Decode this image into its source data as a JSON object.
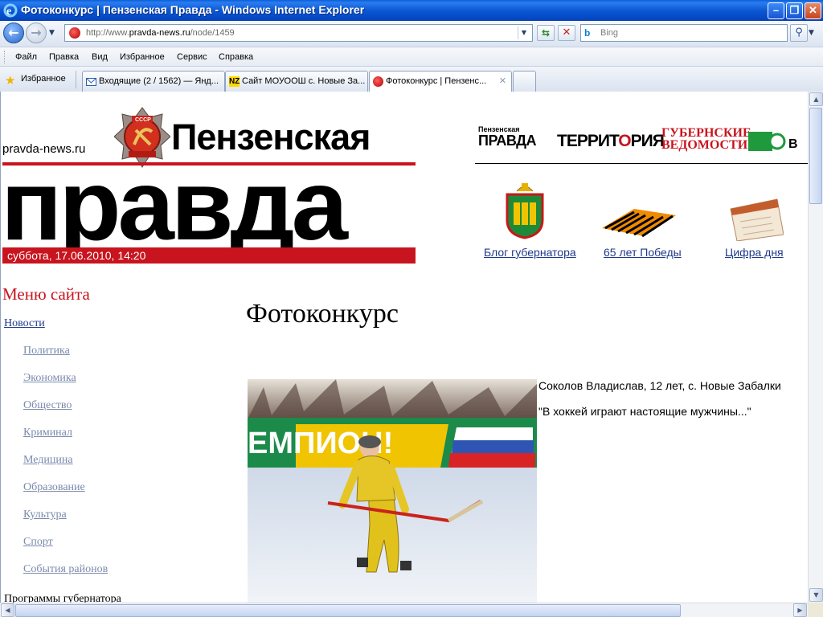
{
  "window": {
    "title": "Фотоконкурс | Пензенская Правда - Windows Internet Explorer",
    "minimize": "–",
    "restore": "❐",
    "close": "✕"
  },
  "address": {
    "url_prefix": "http://www.",
    "url_domain": "pravda-news.ru",
    "url_path": "/node/1459",
    "search_placeholder": "Bing",
    "search_engine": "b"
  },
  "menu": [
    "Файл",
    "Правка",
    "Вид",
    "Избранное",
    "Сервис",
    "Справка"
  ],
  "favorites_label": "Избранное",
  "tabs": [
    {
      "label": "Входящие (2 / 1562) — Янд...",
      "icon": "mail-icon"
    },
    {
      "label": "Сайт МОУООШ с. Новые За...",
      "icon": "nz-icon",
      "icon_text": "NZ"
    },
    {
      "label": "Фотоконкурс | Пензенс...",
      "icon": "site-icon",
      "active": true
    }
  ],
  "header": {
    "site_name": "pravda-news.ru",
    "logo_line1": "Пензенская",
    "logo_line2": "правда",
    "date": "суббота, 17.06.2010, 14:20"
  },
  "partners": {
    "pp_small": "Пензенская",
    "pp_big": "ПРАВДА",
    "territory_a": "ТЕРРИТ",
    "territory_b": "О",
    "territory_c": "РИЯ",
    "gv_line1": "ГУБЕРНСКИЕ",
    "gv_line2": "ВЕДОМОСТИ"
  },
  "quick_links": [
    {
      "label": "Блог губернатора",
      "icon": "coat-of-arms-icon"
    },
    {
      "label": "65 лет Победы",
      "icon": "st-george-ribbon-icon"
    },
    {
      "label": "Цифра дня",
      "icon": "calendar-icon"
    }
  ],
  "sidebar": {
    "title": "Меню сайта",
    "news": "Новости",
    "items": [
      "Политика",
      "Экономика",
      "Общество",
      "Криминал",
      "Медицина",
      "Образование",
      "Культура",
      "Спорт",
      "События районов"
    ],
    "next": "Программы губернатора"
  },
  "article": {
    "title": "Фотоконкурс",
    "author": "Соколов Владислав, 12 лет, с. Новые Забалки",
    "quote": "\"В хоккей играют настоящие мужчины...\"",
    "banner_text": "ЕМПИОН!"
  },
  "colors": {
    "accent_red": "#c8141e",
    "link_blue": "#1f3a8a",
    "sublink_gray": "#7a8aac"
  }
}
